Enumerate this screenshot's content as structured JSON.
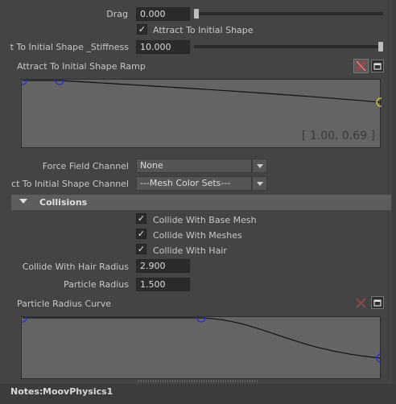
{
  "drag": {
    "label": "Drag",
    "value": "0.000",
    "slider_fraction": 0.0
  },
  "attract": {
    "checkbox_label": "Attract To Initial Shape",
    "checked": true
  },
  "stiffness": {
    "label": "t To Initial Shape _Stiffness",
    "value": "10.000",
    "slider_fraction": 1.0
  },
  "ramp1": {
    "title": "Attract To Initial Shape Ramp",
    "value_readout": "[ 1.00, 0.69 ]",
    "delete_icon": "delete-x-icon",
    "expand_icon": "expand-window-icon",
    "points": [
      {
        "x": 0.0,
        "y": 1.0
      },
      {
        "x": 0.1,
        "y": 1.0
      },
      {
        "x": 1.0,
        "y": 0.69
      }
    ]
  },
  "force_field_channel": {
    "label": "Force Field Channel",
    "value": "None"
  },
  "attract_channel": {
    "label": "ct To Initial Shape Channel",
    "value": "---Mesh Color Sets---"
  },
  "collisions": {
    "title": "Collisions",
    "collide_base_mesh": {
      "label": "Collide With Base Mesh",
      "checked": true
    },
    "collide_meshes": {
      "label": "Collide With Meshes",
      "checked": true
    },
    "collide_hair": {
      "label": "Collide With Hair",
      "checked": true
    },
    "hair_radius": {
      "label": "Collide With Hair Radius",
      "value": "2.900"
    },
    "particle_radius": {
      "label": "Particle Radius",
      "value": "1.500"
    }
  },
  "ramp2": {
    "title": "Particle Radius Curve",
    "delete_icon": "delete-x-icon",
    "expand_icon": "expand-window-icon",
    "points": [
      {
        "x": 0.0,
        "y": 1.0
      },
      {
        "x": 0.5,
        "y": 1.0
      },
      {
        "x": 1.0,
        "y": 0.0
      }
    ]
  },
  "notes": {
    "label": "Notes:",
    "value": "MoovPhysics1"
  },
  "colors": {
    "accent_selected_point": "#d4d43a",
    "control_point": "#2a2ad0",
    "background": "#444444"
  }
}
